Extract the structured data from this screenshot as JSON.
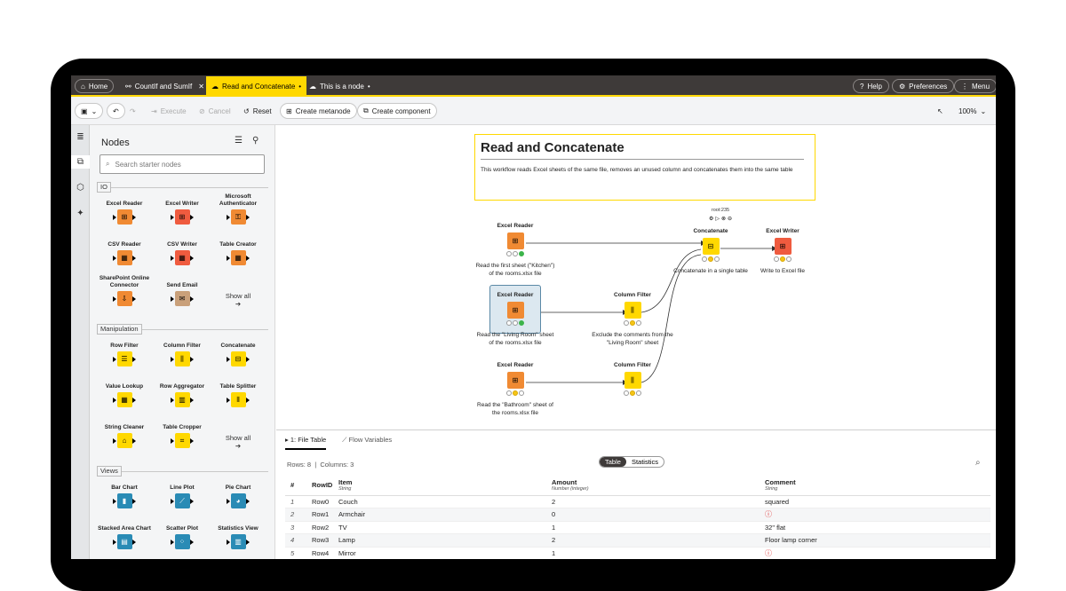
{
  "tabs": {
    "home": "Home",
    "tab1": "CountIf and SumIf",
    "tab2": "Read and Concatenate",
    "tab3": "This is a node",
    "help": "Help",
    "preferences": "Preferences",
    "menu": "Menu"
  },
  "toolbar": {
    "execute": "Execute",
    "cancel": "Cancel",
    "reset": "Reset",
    "create_metanode": "Create metanode",
    "create_component": "Create component",
    "zoom": "100%"
  },
  "side": {
    "title": "Nodes",
    "search_placeholder": "Search starter nodes",
    "cat_io": "IO",
    "cat_manip": "Manipulation",
    "cat_views": "Views",
    "show_all": "Show all",
    "io_nodes": [
      "Excel Reader",
      "Excel Writer",
      "Microsoft Authenticator",
      "CSV Reader",
      "CSV Writer",
      "Table Creator",
      "SharePoint Online Connector",
      "Send Email"
    ],
    "manip_nodes": [
      "Row Filter",
      "Column Filter",
      "Concatenate",
      "Value Lookup",
      "Row Aggregator",
      "Table Splitter",
      "String Cleaner",
      "Table Cropper"
    ],
    "view_nodes": [
      "Bar Chart",
      "Line Plot",
      "Pie Chart",
      "Stacked Area Chart",
      "Scatter Plot",
      "Statistics View"
    ]
  },
  "canvas": {
    "anno_title": "Read and Concatenate",
    "anno_text": "This workflow reads Excel sheets of the same file, removes an unused column and concatenates them into the same table",
    "node_id": "root:235",
    "n1_title": "Excel Reader",
    "n1_desc": "Read the first sheet (\"Kitchen\") of the rooms.xlsx file",
    "n2_title": "Excel Reader",
    "n2_desc": "Read the \"Living Room\" sheet of the rooms.xlsx file",
    "n3_title": "Excel Reader",
    "n3_desc": "Read the \"Bathroom\" sheet of the rooms.xlsx file",
    "n4_title": "Column Filter",
    "n4_desc": "Exclude the comments from the \"Living Room\" sheet",
    "n5_title": "Column Filter",
    "n6_title": "Concatenate",
    "n6_desc": "Concatenate in a single table",
    "n7_title": "Excel Writer",
    "n7_desc": "Write to Excel file"
  },
  "bottom": {
    "tab_table": "1: File Table",
    "tab_flow": "Flow Variables",
    "rows": "Rows: 8",
    "cols": "Columns: 3",
    "seg_table": "Table",
    "seg_stats": "Statistics",
    "headers": [
      "#",
      "RowID",
      "Item",
      "Amount",
      "Comment"
    ],
    "types": [
      "",
      "",
      "String",
      "Number (integer)",
      "String"
    ],
    "rows_data": [
      [
        "1",
        "Row0",
        "Couch",
        "2",
        "squared"
      ],
      [
        "2",
        "Row1",
        "Armchair",
        "0",
        "?"
      ],
      [
        "3",
        "Row2",
        "TV",
        "1",
        "32\" flat"
      ],
      [
        "4",
        "Row3",
        "Lamp",
        "2",
        "Floor lamp corner"
      ],
      [
        "5",
        "Row4",
        "Mirror",
        "1",
        "?"
      ]
    ]
  },
  "colors": {
    "accent": "#ffd800",
    "reader": "#f08a33",
    "writer": "#ef5b3f",
    "manip": "#ffd800",
    "view": "#2a8bb5"
  }
}
